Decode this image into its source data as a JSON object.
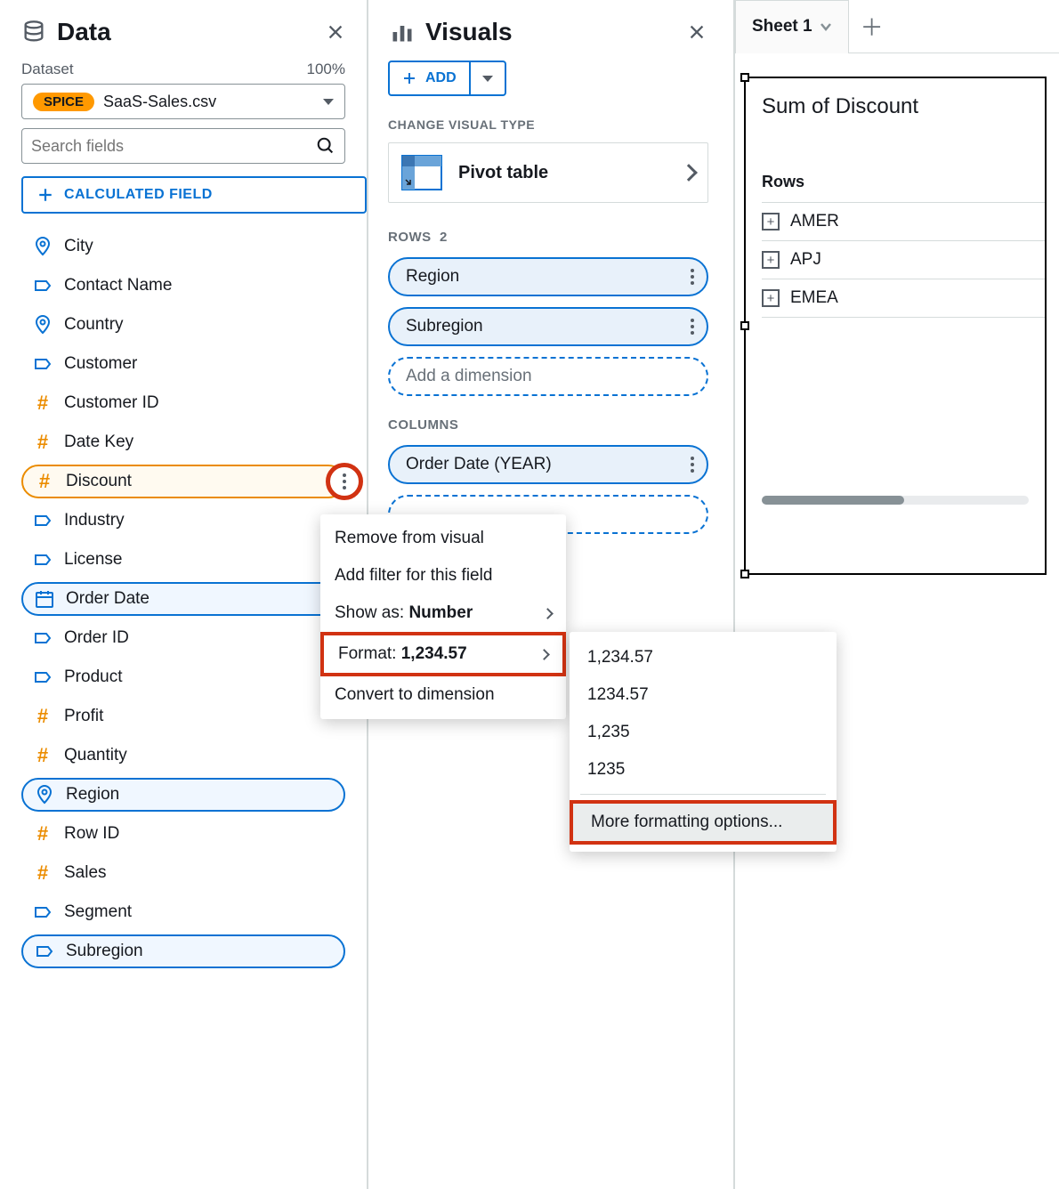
{
  "data_panel": {
    "title": "Data",
    "dataset_label": "Dataset",
    "zoom": "100%",
    "spice_badge": "SPICE",
    "dataset_name": "SaaS-Sales.csv",
    "search_placeholder": "Search fields",
    "calculated_field_btn": "CALCULATED FIELD",
    "fields": [
      {
        "icon": "pin",
        "label": "City"
      },
      {
        "icon": "tag",
        "label": "Contact Name"
      },
      {
        "icon": "pin",
        "label": "Country"
      },
      {
        "icon": "tag",
        "label": "Customer"
      },
      {
        "icon": "hash",
        "label": "Customer ID"
      },
      {
        "icon": "hash",
        "label": "Date Key"
      },
      {
        "icon": "hash",
        "label": "Discount",
        "selected": "orange",
        "dots": true
      },
      {
        "icon": "tag",
        "label": "Industry"
      },
      {
        "icon": "tag",
        "label": "License"
      },
      {
        "icon": "cal",
        "label": "Order Date",
        "selected": "blue"
      },
      {
        "icon": "tag",
        "label": "Order ID"
      },
      {
        "icon": "tag",
        "label": "Product"
      },
      {
        "icon": "hash",
        "label": "Profit"
      },
      {
        "icon": "hash",
        "label": "Quantity"
      },
      {
        "icon": "pin",
        "label": "Region",
        "selected": "blue"
      },
      {
        "icon": "hash",
        "label": "Row ID"
      },
      {
        "icon": "hash",
        "label": "Sales"
      },
      {
        "icon": "tag",
        "label": "Segment"
      },
      {
        "icon": "tag",
        "label": "Subregion",
        "selected": "blue"
      }
    ]
  },
  "visuals_panel": {
    "title": "Visuals",
    "add_btn": "ADD",
    "change_type_label": "CHANGE VISUAL TYPE",
    "visual_type": "Pivot table",
    "rows_label": "ROWS",
    "rows_count": "2",
    "rows": [
      "Region",
      "Subregion"
    ],
    "rows_placeholder": "Add a dimension",
    "columns_label": "COLUMNS",
    "columns": [
      "Order Date (YEAR)"
    ],
    "columns_placeholder": ""
  },
  "context_menu": {
    "items": [
      {
        "label": "Remove from visual"
      },
      {
        "label": "Add filter for this field"
      },
      {
        "prefix": "Show as: ",
        "bold": "Number",
        "arrow": true
      },
      {
        "prefix": "Format: ",
        "bold": "1,234.57",
        "arrow": true,
        "highlight": true
      },
      {
        "label": "Convert to dimension"
      }
    ]
  },
  "format_submenu": {
    "options": [
      "1,234.57",
      "1234.57",
      "1,235",
      "1235"
    ],
    "more": "More formatting options..."
  },
  "sheet_panel": {
    "tab": "Sheet 1",
    "vis_title": "Sum of Discount",
    "rows_header": "Rows",
    "rows": [
      "AMER",
      "APJ",
      "EMEA"
    ]
  }
}
